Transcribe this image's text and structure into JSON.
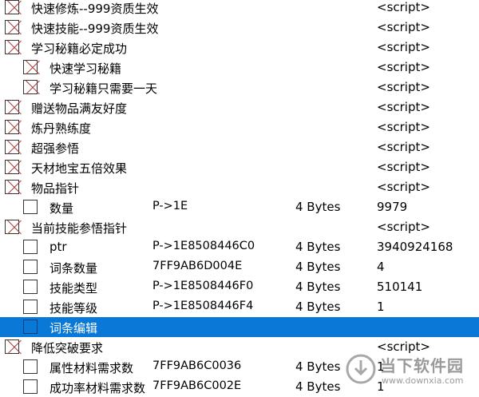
{
  "rows": [
    {
      "level": 0,
      "checked": true,
      "desc": "快速修炼--999资质生效",
      "address": "",
      "type": "",
      "value": "<script>"
    },
    {
      "level": 0,
      "checked": true,
      "desc": "快速技能--999资质生效",
      "address": "",
      "type": "",
      "value": "<script>"
    },
    {
      "level": 0,
      "checked": true,
      "desc": "学习秘籍必定成功",
      "address": "",
      "type": "",
      "value": "<script>"
    },
    {
      "level": 1,
      "checked": true,
      "desc": "快速学习秘籍",
      "address": "",
      "type": "",
      "value": "<script>"
    },
    {
      "level": 1,
      "checked": true,
      "desc": "学习秘籍只需要一天",
      "address": "",
      "type": "",
      "value": "<script>"
    },
    {
      "level": 0,
      "checked": true,
      "desc": "赠送物品满友好度",
      "address": "",
      "type": "",
      "value": "<script>"
    },
    {
      "level": 0,
      "checked": true,
      "desc": "炼丹熟练度",
      "address": "",
      "type": "",
      "value": "<script>"
    },
    {
      "level": 0,
      "checked": true,
      "desc": "超强参悟",
      "address": "",
      "type": "",
      "value": "<script>"
    },
    {
      "level": 0,
      "checked": true,
      "desc": "天材地宝五倍效果",
      "address": "",
      "type": "",
      "value": "<script>"
    },
    {
      "level": 0,
      "checked": true,
      "desc": "物品指针",
      "address": "",
      "type": "",
      "value": "<script>"
    },
    {
      "level": 1,
      "checked": false,
      "desc": "数量",
      "address": "P->1E",
      "type": "4 Bytes",
      "value": "9979"
    },
    {
      "level": 0,
      "checked": true,
      "desc": "当前技能参悟指针",
      "address": "",
      "type": "",
      "value": "<script>"
    },
    {
      "level": 1,
      "checked": false,
      "desc": "ptr",
      "address": "P->1E8508446C0",
      "type": "4 Bytes",
      "value": "3940924168"
    },
    {
      "level": 1,
      "checked": false,
      "desc": "词条数量",
      "address": "7FF9AB6D004E",
      "type": "4 Bytes",
      "value": "4"
    },
    {
      "level": 1,
      "checked": false,
      "desc": "技能类型",
      "address": "P->1E8508446F0",
      "type": "4 Bytes",
      "value": "510141"
    },
    {
      "level": 1,
      "checked": false,
      "desc": "技能等级",
      "address": "P->1E8508446F4",
      "type": "4 Bytes",
      "value": "1"
    },
    {
      "level": 1,
      "checked": false,
      "selected": true,
      "desc": "词条编辑",
      "address": "",
      "type": "",
      "value": ""
    },
    {
      "level": 0,
      "checked": true,
      "desc": "降低突破要求",
      "address": "",
      "type": "",
      "value": "<script>"
    },
    {
      "level": 1,
      "checked": false,
      "desc": "属性材料需求数",
      "address": "7FF9AB6C0036",
      "type": "4 Bytes",
      "value": "1"
    },
    {
      "level": 1,
      "checked": false,
      "desc": "成功率材料需求数",
      "address": "7FF9AB6C002E",
      "type": "4 Bytes",
      "value": "1"
    }
  ],
  "watermark": {
    "name": "当下软件园",
    "url": "www.downxia.com",
    "color": "#9a9a9a"
  },
  "colors": {
    "selection": "#0a78d7",
    "check_mark": "#b23b3b"
  }
}
